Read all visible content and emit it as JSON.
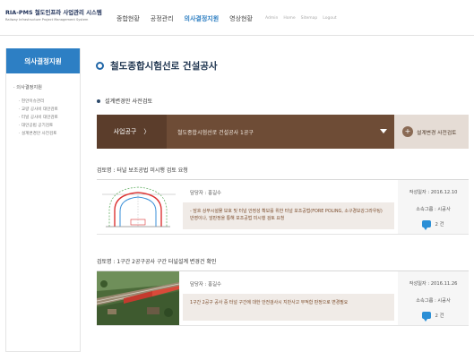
{
  "header": {
    "logo_title": "RIA-PMS 철도인프라 사업관리 시스템",
    "logo_subtitle": "Railway Infrastructure Project Management System",
    "nav": [
      "종합현황",
      "공정관리",
      "의사결정지원",
      "영상현황"
    ],
    "util": [
      "Admin",
      "Home",
      "Sitemap",
      "Logout"
    ]
  },
  "sidebar": {
    "title": "의사결정지원",
    "group": "· 의사결정지원",
    "items": [
      "· 현안이슈관리",
      "· 교량 공사비 대안검토",
      "· 터널 공사비 대안검토",
      "· 대안공법 공기검토",
      "· 설계변경안 사전검토"
    ]
  },
  "main": {
    "page_title": "철도종합시험선로 건설공사",
    "section_title": "설계변경안 사전검토",
    "select": {
      "left_label": "사업공구",
      "left_arrow": "〉",
      "value": "철도종합시험선로 건설공사 1공구",
      "button_icon": "+",
      "button_label": "설계변경 사전검토"
    },
    "reviews": [
      {
        "title": "검토명 : 터널 보조공법 미시행 검토 요청",
        "assignee": "담당자 : 홍길수",
        "content": "- 담흐 상부시설물 보호 및 터널 안정성 확보를 위한 터널 보조공법(FORE POLING, 소구경보강그라우팅) 반영이나, 암판정을 통해 보조공법 미시행 검토 요청",
        "date": "작성일자 : 2016.12.10",
        "dept": "소속그룹 : 시공사",
        "count": "2 건"
      },
      {
        "title": "검토명 : 1구간 2공구공사 구간 터널설계 변경건 확인",
        "assignee": "담당자 : 홍길수",
        "content": "1구간 2공구 공사 중 터널 구간에 대한 안전검사시 지반사고 부적합 판정으로 변경필요",
        "date": "작성일자 : 2016.11.26",
        "dept": "소속그룹 : 시공사",
        "count": "2 건"
      }
    ]
  },
  "colors": {
    "accent": "#2d7fc4",
    "select_dark": "#5b3d2b",
    "select_main": "#6e4c36",
    "button_bg": "#e5dcd5",
    "content_bg": "#f0ebe7"
  }
}
